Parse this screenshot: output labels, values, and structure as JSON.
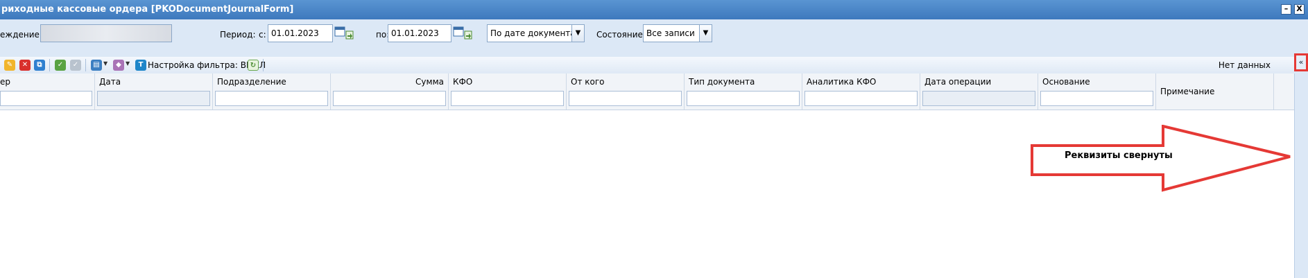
{
  "window": {
    "title": "риходные кассовые ордера [PKODocumentJournalForm]",
    "minimize_label": "–",
    "close_label": "X"
  },
  "filters": {
    "institution_label": "еждение:",
    "period_label": "Период:",
    "from_label": "с:",
    "from_value": "01.01.2023",
    "to_label": "по:",
    "to_value": "01.01.2023",
    "date_mode_value": "По дате документа",
    "state_label": "Состояние:",
    "state_value": "Все записи"
  },
  "toolbar": {
    "filter_settings_label": "Настройка фильтра: ВЫКЛ",
    "no_data_label": "Нет данных",
    "collapse_label": "«"
  },
  "columns": [
    {
      "header": "ер"
    },
    {
      "header": "Дата"
    },
    {
      "header": "Подразделение"
    },
    {
      "header": "Сумма"
    },
    {
      "header": "КФО"
    },
    {
      "header": "От кого"
    },
    {
      "header": "Тип документа"
    },
    {
      "header": "Аналитика КФО"
    },
    {
      "header": "Дата операции"
    },
    {
      "header": "Основание"
    },
    {
      "header": "Примечание"
    }
  ],
  "annotation": {
    "text": "Реквизиты свернуты",
    "color": "#e53935"
  }
}
